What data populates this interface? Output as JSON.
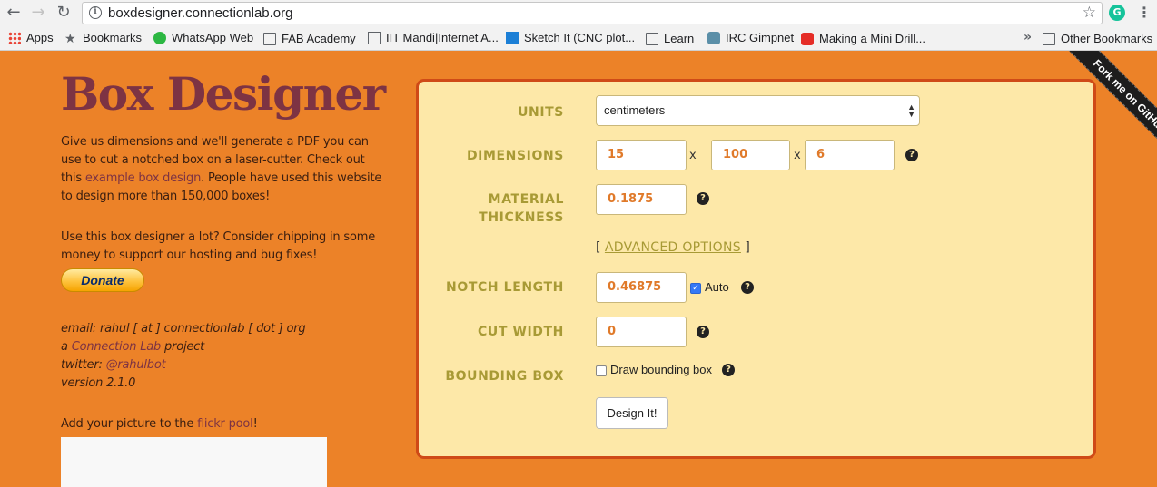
{
  "browser": {
    "url": "boxdesigner.connectionlab.org",
    "bookmarks": [
      {
        "label": "Apps",
        "icon": "apps-grid-icon"
      },
      {
        "label": "Bookmarks",
        "icon": "star-icon"
      },
      {
        "label": "WhatsApp Web",
        "icon": "whatsapp-icon"
      },
      {
        "label": "FAB Academy",
        "icon": "folder-icon"
      },
      {
        "label": "IIT Mandi|Internet A...",
        "icon": "page-icon"
      },
      {
        "label": "Sketch It (CNC plot...",
        "icon": "sketch-icon"
      },
      {
        "label": "Learn",
        "icon": "folder-icon"
      },
      {
        "label": "IRC Gimpnet",
        "icon": "irc-icon"
      },
      {
        "label": "Making a Mini Drill...",
        "icon": "youtube-icon"
      }
    ],
    "other_bookmarks": "Other Bookmarks",
    "extension_letter": "G"
  },
  "left": {
    "title": "Box Designer",
    "intro_1": "Give us dimensions and we'll generate a PDF you can use to cut a notched box on a laser-cutter. Check out this ",
    "intro_link": "example box design",
    "intro_2": ". People have used this website to design more than 150,000 boxes!",
    "support": "Use this box designer a lot? Consider chipping in some money to support our hosting and bug fixes!",
    "donate_label": "Donate",
    "email": "email: rahul [ at ] connectionlab [ dot ] org",
    "project_prefix": "a ",
    "project_link": "Connection Lab",
    "project_suffix": " project",
    "twitter_prefix": "twitter: ",
    "twitter_link": "@rahulbot",
    "version": "version 2.1.0",
    "flickr_prefix": "Add your picture to the ",
    "flickr_link": "flickr pool",
    "flickr_suffix": "!"
  },
  "form": {
    "units_label": "UNITS",
    "units_value": "centimeters",
    "dimensions_label": "DIMENSIONS",
    "dim_width": "15",
    "dim_height": "100",
    "dim_depth": "6",
    "times": "x",
    "thickness_label_1": "MATERIAL",
    "thickness_label_2": "THICKNESS",
    "thickness_value": "0.1875",
    "advanced_open": "[ ",
    "advanced_label": "ADVANCED OPTIONS",
    "advanced_close": " ]",
    "notch_label": "NOTCH LENGTH",
    "notch_value": "0.46875",
    "auto_label": "Auto",
    "cut_label": "CUT WIDTH",
    "cut_value": "0",
    "bounding_label": "BOUNDING BOX",
    "bounding_check_label": "Draw bounding box",
    "design_button": "Design It!",
    "help_glyph": "?"
  },
  "ribbon": {
    "label": "Fork me on GitHub"
  },
  "colors": {
    "page_bg": "#ec8228",
    "title": "#7d3343",
    "card_bg": "#fde8a8",
    "card_border": "#cf4a17",
    "label": "#a89a35",
    "input_text": "#e07a2a"
  }
}
